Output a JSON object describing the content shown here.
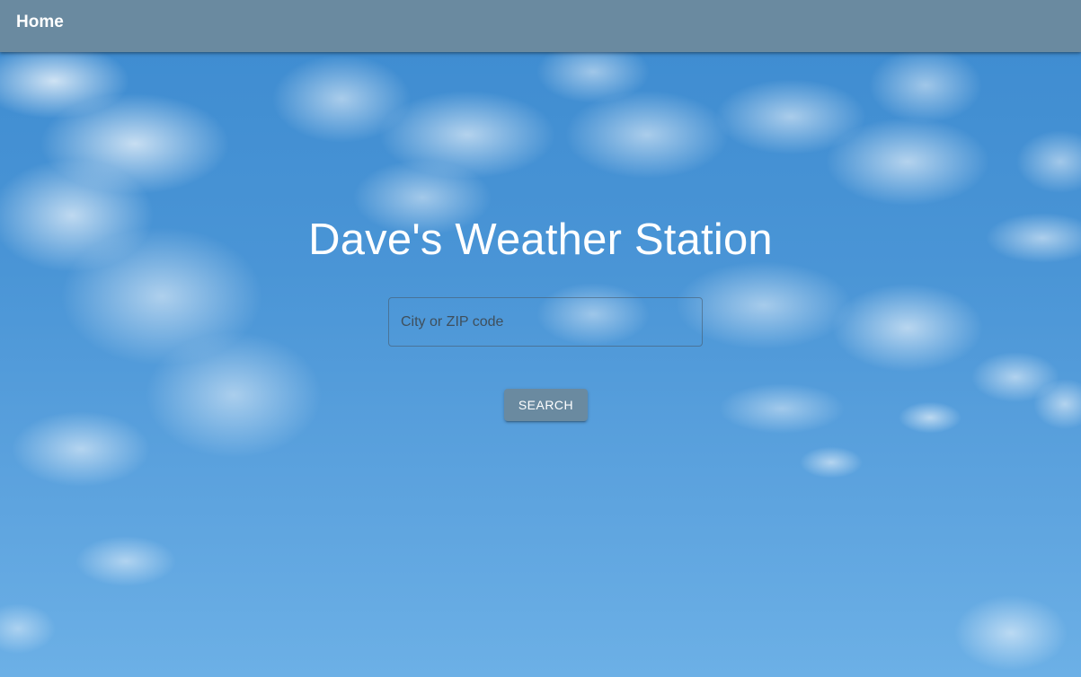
{
  "nav": {
    "home_label": "Home"
  },
  "main": {
    "title": "Dave's Weather Station",
    "search": {
      "placeholder": "City or ZIP code",
      "value": ""
    },
    "search_button_label": "SEARCH"
  },
  "background": {
    "image": "sky-with-clouds"
  },
  "colors": {
    "app_bar": "#6a8aa0",
    "button": "#6a8aa0",
    "sky": "#4a95d6",
    "title_text": "#ffffff"
  }
}
